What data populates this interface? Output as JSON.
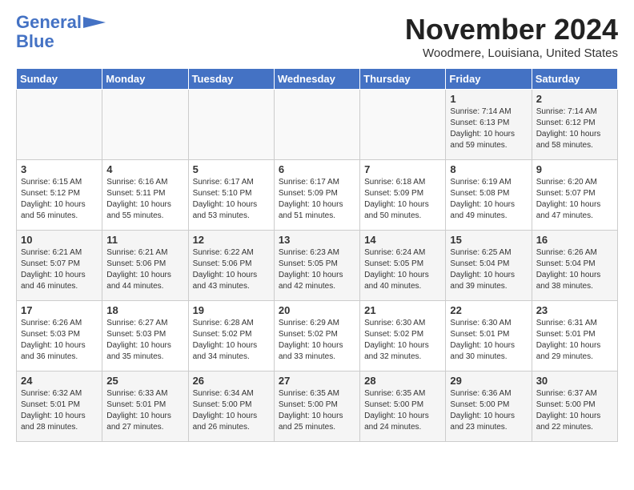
{
  "header": {
    "logo_line1": "General",
    "logo_line2": "Blue",
    "title": "November 2024",
    "subtitle": "Woodmere, Louisiana, United States"
  },
  "days_of_week": [
    "Sunday",
    "Monday",
    "Tuesday",
    "Wednesday",
    "Thursday",
    "Friday",
    "Saturday"
  ],
  "weeks": [
    [
      {
        "day": "",
        "info": ""
      },
      {
        "day": "",
        "info": ""
      },
      {
        "day": "",
        "info": ""
      },
      {
        "day": "",
        "info": ""
      },
      {
        "day": "",
        "info": ""
      },
      {
        "day": "1",
        "info": "Sunrise: 7:14 AM\nSunset: 6:13 PM\nDaylight: 10 hours\nand 59 minutes."
      },
      {
        "day": "2",
        "info": "Sunrise: 7:14 AM\nSunset: 6:12 PM\nDaylight: 10 hours\nand 58 minutes."
      }
    ],
    [
      {
        "day": "3",
        "info": "Sunrise: 6:15 AM\nSunset: 5:12 PM\nDaylight: 10 hours\nand 56 minutes."
      },
      {
        "day": "4",
        "info": "Sunrise: 6:16 AM\nSunset: 5:11 PM\nDaylight: 10 hours\nand 55 minutes."
      },
      {
        "day": "5",
        "info": "Sunrise: 6:17 AM\nSunset: 5:10 PM\nDaylight: 10 hours\nand 53 minutes."
      },
      {
        "day": "6",
        "info": "Sunrise: 6:17 AM\nSunset: 5:09 PM\nDaylight: 10 hours\nand 51 minutes."
      },
      {
        "day": "7",
        "info": "Sunrise: 6:18 AM\nSunset: 5:09 PM\nDaylight: 10 hours\nand 50 minutes."
      },
      {
        "day": "8",
        "info": "Sunrise: 6:19 AM\nSunset: 5:08 PM\nDaylight: 10 hours\nand 49 minutes."
      },
      {
        "day": "9",
        "info": "Sunrise: 6:20 AM\nSunset: 5:07 PM\nDaylight: 10 hours\nand 47 minutes."
      }
    ],
    [
      {
        "day": "10",
        "info": "Sunrise: 6:21 AM\nSunset: 5:07 PM\nDaylight: 10 hours\nand 46 minutes."
      },
      {
        "day": "11",
        "info": "Sunrise: 6:21 AM\nSunset: 5:06 PM\nDaylight: 10 hours\nand 44 minutes."
      },
      {
        "day": "12",
        "info": "Sunrise: 6:22 AM\nSunset: 5:06 PM\nDaylight: 10 hours\nand 43 minutes."
      },
      {
        "day": "13",
        "info": "Sunrise: 6:23 AM\nSunset: 5:05 PM\nDaylight: 10 hours\nand 42 minutes."
      },
      {
        "day": "14",
        "info": "Sunrise: 6:24 AM\nSunset: 5:05 PM\nDaylight: 10 hours\nand 40 minutes."
      },
      {
        "day": "15",
        "info": "Sunrise: 6:25 AM\nSunset: 5:04 PM\nDaylight: 10 hours\nand 39 minutes."
      },
      {
        "day": "16",
        "info": "Sunrise: 6:26 AM\nSunset: 5:04 PM\nDaylight: 10 hours\nand 38 minutes."
      }
    ],
    [
      {
        "day": "17",
        "info": "Sunrise: 6:26 AM\nSunset: 5:03 PM\nDaylight: 10 hours\nand 36 minutes."
      },
      {
        "day": "18",
        "info": "Sunrise: 6:27 AM\nSunset: 5:03 PM\nDaylight: 10 hours\nand 35 minutes."
      },
      {
        "day": "19",
        "info": "Sunrise: 6:28 AM\nSunset: 5:02 PM\nDaylight: 10 hours\nand 34 minutes."
      },
      {
        "day": "20",
        "info": "Sunrise: 6:29 AM\nSunset: 5:02 PM\nDaylight: 10 hours\nand 33 minutes."
      },
      {
        "day": "21",
        "info": "Sunrise: 6:30 AM\nSunset: 5:02 PM\nDaylight: 10 hours\nand 32 minutes."
      },
      {
        "day": "22",
        "info": "Sunrise: 6:30 AM\nSunset: 5:01 PM\nDaylight: 10 hours\nand 30 minutes."
      },
      {
        "day": "23",
        "info": "Sunrise: 6:31 AM\nSunset: 5:01 PM\nDaylight: 10 hours\nand 29 minutes."
      }
    ],
    [
      {
        "day": "24",
        "info": "Sunrise: 6:32 AM\nSunset: 5:01 PM\nDaylight: 10 hours\nand 28 minutes."
      },
      {
        "day": "25",
        "info": "Sunrise: 6:33 AM\nSunset: 5:01 PM\nDaylight: 10 hours\nand 27 minutes."
      },
      {
        "day": "26",
        "info": "Sunrise: 6:34 AM\nSunset: 5:00 PM\nDaylight: 10 hours\nand 26 minutes."
      },
      {
        "day": "27",
        "info": "Sunrise: 6:35 AM\nSunset: 5:00 PM\nDaylight: 10 hours\nand 25 minutes."
      },
      {
        "day": "28",
        "info": "Sunrise: 6:35 AM\nSunset: 5:00 PM\nDaylight: 10 hours\nand 24 minutes."
      },
      {
        "day": "29",
        "info": "Sunrise: 6:36 AM\nSunset: 5:00 PM\nDaylight: 10 hours\nand 23 minutes."
      },
      {
        "day": "30",
        "info": "Sunrise: 6:37 AM\nSunset: 5:00 PM\nDaylight: 10 hours\nand 22 minutes."
      }
    ]
  ]
}
